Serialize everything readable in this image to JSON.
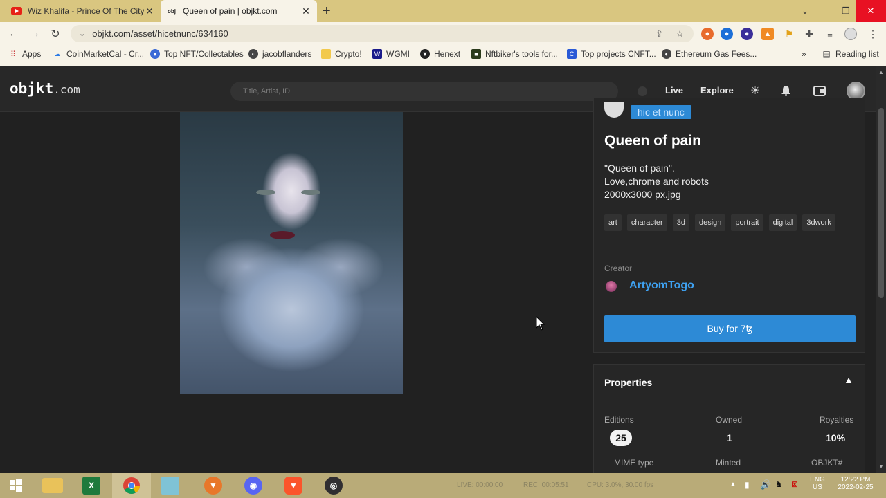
{
  "browser": {
    "tabs": [
      {
        "title": "Wiz Khalifa - Prince Of The City 2",
        "favicon": "youtube-icon",
        "active": false
      },
      {
        "title": "Queen of pain | objkt.com",
        "favicon": "objkt-icon",
        "active": true
      }
    ],
    "url": "objkt.com/asset/hicetnunc/634160",
    "bookmarks": [
      {
        "label": "Apps"
      },
      {
        "label": "CoinMarketCal - Cr..."
      },
      {
        "label": "Top NFT/Collectables"
      },
      {
        "label": "jacobflanders"
      },
      {
        "label": "Crypto!"
      },
      {
        "label": "WGMI"
      },
      {
        "label": "Henext"
      },
      {
        "label": "Nftbiker's tools for..."
      },
      {
        "label": "Top projects CNFT..."
      },
      {
        "label": "Ethereum Gas Fees..."
      }
    ],
    "reading_list": "Reading list"
  },
  "site": {
    "logo_main": "objkt",
    "logo_suffix": ".com",
    "search_placeholder": "Title, Artist, ID",
    "nav": {
      "live": "Live",
      "explore": "Explore"
    }
  },
  "asset": {
    "platform": "hic et nunc",
    "title": "Queen of pain",
    "description": [
      "\"Queen of pain\".",
      "Love,chrome and robots",
      "2000x3000 px.jpg"
    ],
    "tags": [
      "art",
      "character",
      "3d",
      "design",
      "portrait",
      "digital",
      "3dwork"
    ],
    "creator_label": "Creator",
    "creator_name": "ArtyomTogo",
    "buy_label": "Buy for 7ꜩ"
  },
  "properties": {
    "title": "Properties",
    "editions_label": "Editions",
    "editions_value": "25",
    "owned_label": "Owned",
    "owned_value": "1",
    "royalties_label": "Royalties",
    "royalties_value": "10%",
    "mime_label": "MIME type",
    "minted_label": "Minted",
    "objkt_label": "OBJKT#"
  },
  "taskbar": {
    "live": "LIVE: 00:00:00",
    "rec": "REC: 00:05:51",
    "cpu": "CPU: 3.0%, 30.00 fps",
    "lang": "ENG",
    "region": "US",
    "time": "12:22 PM",
    "date": "2022-02-25"
  },
  "colors": {
    "accent": "#2d8ad6",
    "creator_link": "#3ea0ef",
    "background": "#212121"
  }
}
